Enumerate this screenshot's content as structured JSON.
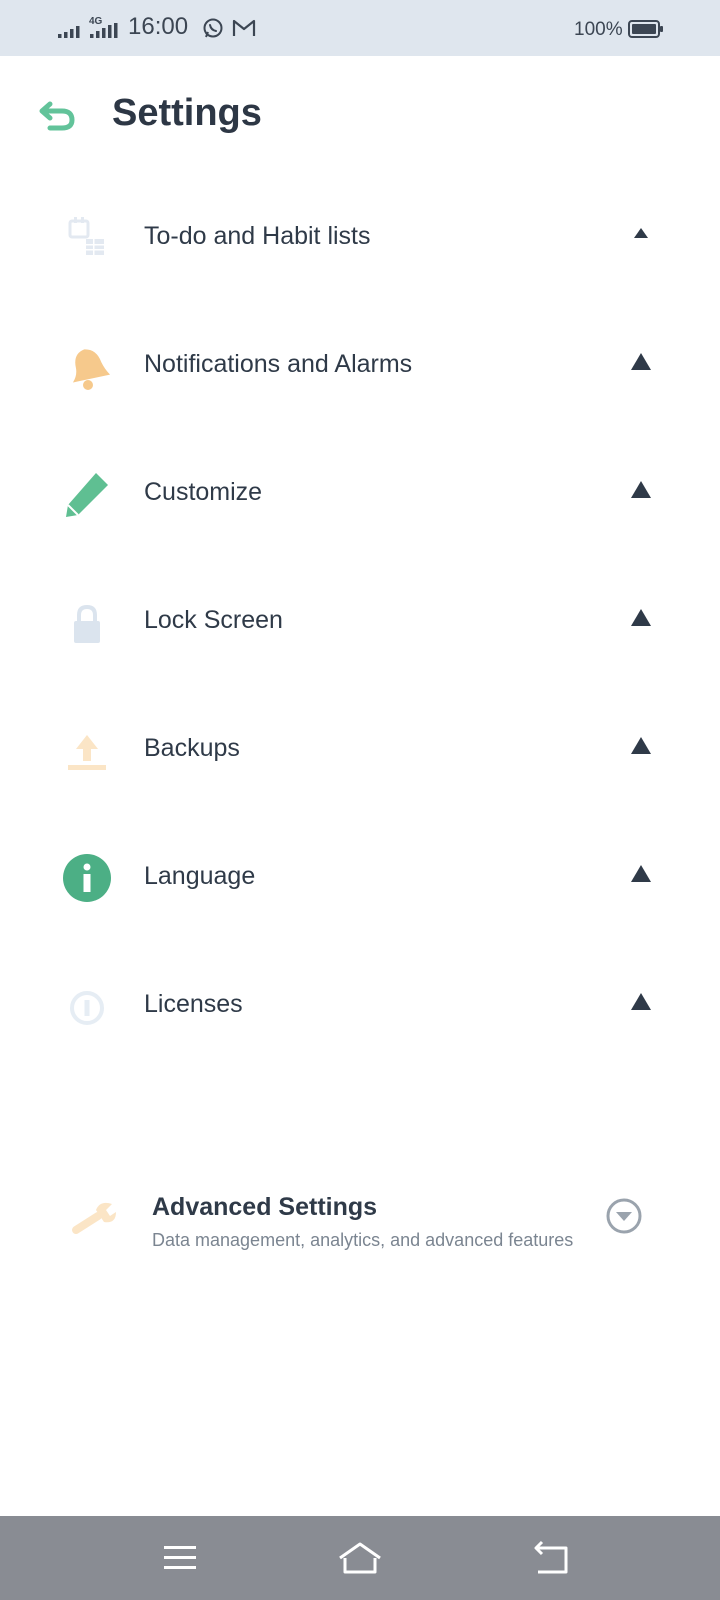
{
  "status_bar": {
    "time": "16:00",
    "network": "4G",
    "battery": "100%",
    "icons": [
      "signal-icon",
      "4g-signal-icon",
      "whatsapp-icon",
      "gmail-icon",
      "battery-icon"
    ]
  },
  "header": {
    "title": "Settings",
    "back_icon": "back-arrow-icon"
  },
  "settings": [
    {
      "label": "To-do and Habit lists",
      "icon": "calendar-list-icon"
    },
    {
      "label": "Notifications and Alarms",
      "icon": "bell-icon"
    },
    {
      "label": "Customize",
      "icon": "pencil-icon"
    },
    {
      "label": "Lock Screen",
      "icon": "lock-icon"
    },
    {
      "label": "Backups",
      "icon": "upload-icon"
    },
    {
      "label": "Language",
      "icon": "info-icon"
    },
    {
      "label": "Licenses",
      "icon": "license-icon"
    }
  ],
  "advanced": {
    "title": "Advanced Settings",
    "subtitle": "Data management, analytics, and advanced features",
    "icon": "wrench-icon",
    "chevron": "chevron-down-circle-icon"
  },
  "nav_bar": {
    "icons": [
      "menu-icon",
      "home-icon",
      "back-icon"
    ]
  },
  "colors": {
    "accent_green": "#4caf85",
    "bell_orange": "#f6c98c",
    "status_bar_bg": "#dfe6ee",
    "nav_bar_bg": "#898c93",
    "text": "#2f3a48"
  }
}
